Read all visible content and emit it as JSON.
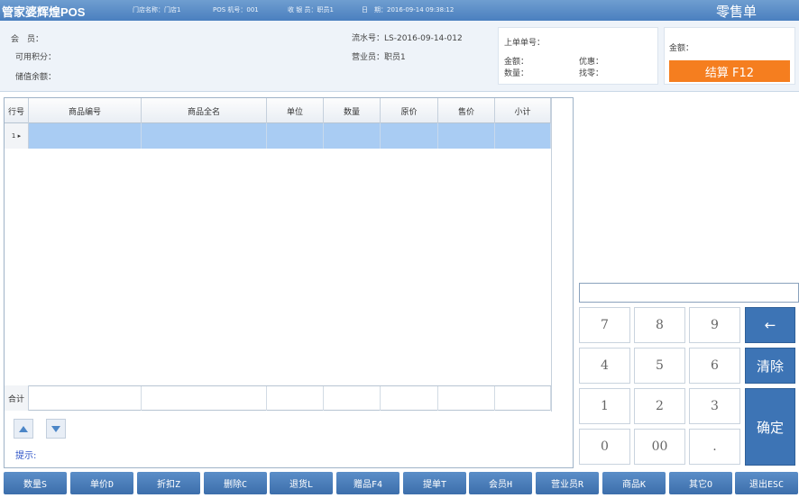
{
  "titlebar": {
    "app_title": "管家婆辉煌POS",
    "store": "门店名称：门店1",
    "pos_no": "POS 机号：001",
    "cashier": "收 银 员：职员1",
    "date": "日　期：2016-09-14 09:38:12",
    "mode": "零售单"
  },
  "info": {
    "member_label": "会　员：",
    "points_label": "可用积分：",
    "balance_label": "储值余额：",
    "serial": "流水号：LS-2016-09-14-012",
    "salesperson": "营业员：职员1",
    "last_order_label": "上单单号：",
    "amount_label": "金额：",
    "discount_label": "优惠：",
    "qty_label": "数量：",
    "change_label": "找零：",
    "total_amount_label": "金额：",
    "settle_label": "结算 F12"
  },
  "grid": {
    "columns": [
      "行号",
      "商品编号",
      "商品全名",
      "单位",
      "数量",
      "原价",
      "售价",
      "小计"
    ],
    "rows": [
      {
        "row_no": "1 ▸"
      }
    ],
    "total_label": "合计"
  },
  "hint": {
    "label": "提示:"
  },
  "keypad": {
    "keys": [
      "7",
      "8",
      "9",
      "4",
      "5",
      "6",
      "1",
      "2",
      "3",
      "0",
      "00",
      "."
    ],
    "backspace": "←",
    "clear": "清除",
    "confirm": "确定"
  },
  "functions": [
    "数量S",
    "单价D",
    "折扣Z",
    "删除C",
    "退货L",
    "赠品F4",
    "提单T",
    "会员H",
    "营业员R",
    "商品K",
    "其它O",
    "退出ESC"
  ],
  "colors": {
    "titlebar": "#4a7fbf",
    "settle": "#f57e1f",
    "selected_row": "#a9ccf3",
    "keypad_blue": "#3d74b5",
    "hint_text": "#2f55c8"
  }
}
